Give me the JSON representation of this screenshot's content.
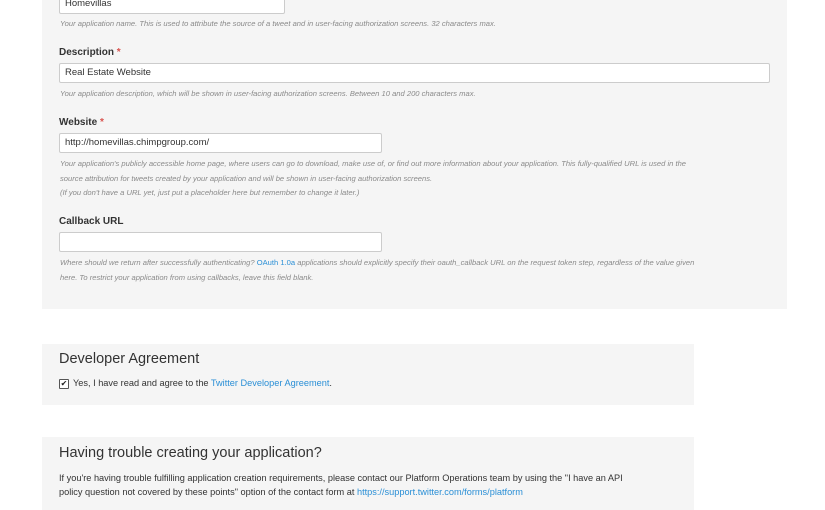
{
  "form": {
    "name_value": "Homevillas",
    "name_help": "Your application name. This is used to attribute the source of a tweet and in user-facing authorization screens. 32 characters max.",
    "description_label": "Description",
    "description_value": "Real Estate Website",
    "description_help": "Your application description, which will be shown in user-facing authorization screens. Between 10 and 200 characters max.",
    "website_label": "Website",
    "website_value": "http://homevillas.chimpgroup.com/",
    "website_help_line1": "Your application's publicly accessible home page, where users can go to download, make use of, or find out more information about your application. This fully-qualified URL is used in the",
    "website_help_line2": "source attribution for tweets created by your application and will be shown in user-facing authorization screens.",
    "website_help_line3": "(If you don't have a URL yet, just put a placeholder here but remember to change it later.)",
    "callback_label": "Callback URL",
    "callback_value": "",
    "callback_help_pre": "Where should we return after successfully authenticating? ",
    "callback_help_link": "OAuth 1.0a",
    "callback_help_post": " applications should explicitly specify their oauth_callback URL on the request token step, regardless of the value given",
    "callback_help_line2": "here. To restrict your application from using callbacks, leave this field blank.",
    "required_mark": "*"
  },
  "agreement": {
    "heading": "Developer Agreement",
    "checkbox_glyph": "✔",
    "text_pre": "Yes, I have read and agree to the ",
    "link": "Twitter Developer Agreement",
    "text_post": "."
  },
  "trouble": {
    "heading": "Having trouble creating your application?",
    "line1": "If you're having trouble fulfilling application creation requirements, please contact our Platform Operations team by using the \"I have an API",
    "line2_pre": "policy question not covered by these points\" option of the contact form at ",
    "line2_link": "https://support.twitter.com/forms/platform"
  }
}
